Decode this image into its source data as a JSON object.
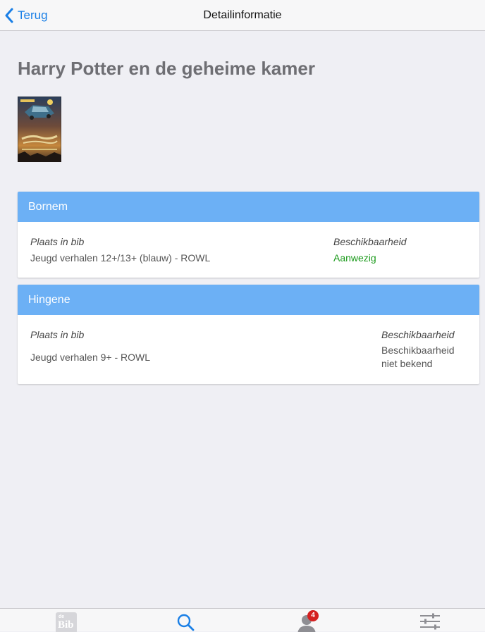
{
  "nav": {
    "back_label": "Terug",
    "title": "Detailinformatie"
  },
  "book": {
    "title": "Harry Potter en de geheime kamer",
    "cover": {
      "author_text": "J.K. ROWLING",
      "title_text": "Harry Potter",
      "subtitle_text": "en de geheime kamer"
    }
  },
  "locations": [
    {
      "branch": "Bornem",
      "place_label": "Plaats in bib",
      "place_value": "Jeugd verhalen 12+/13+ (blauw) - ROWL",
      "availability_label": "Beschikbaarheid",
      "availability_value": "Aanwezig"
    },
    {
      "branch": "Hingene",
      "place_label": "Plaats in bib",
      "place_value": "Jeugd verhalen 9+ - ROWL",
      "availability_label": "Beschikbaarheid",
      "availability_value": "Beschikbaarheid niet bekend"
    }
  ],
  "tabbar": {
    "home_logo_text_top": "de",
    "home_logo_text_main": "Bib",
    "account_badge": "4"
  },
  "colors": {
    "accent": "#1a7fe6",
    "card_header": "#6cb0f5",
    "available": "#1a9a1a",
    "badge": "#d42020"
  }
}
